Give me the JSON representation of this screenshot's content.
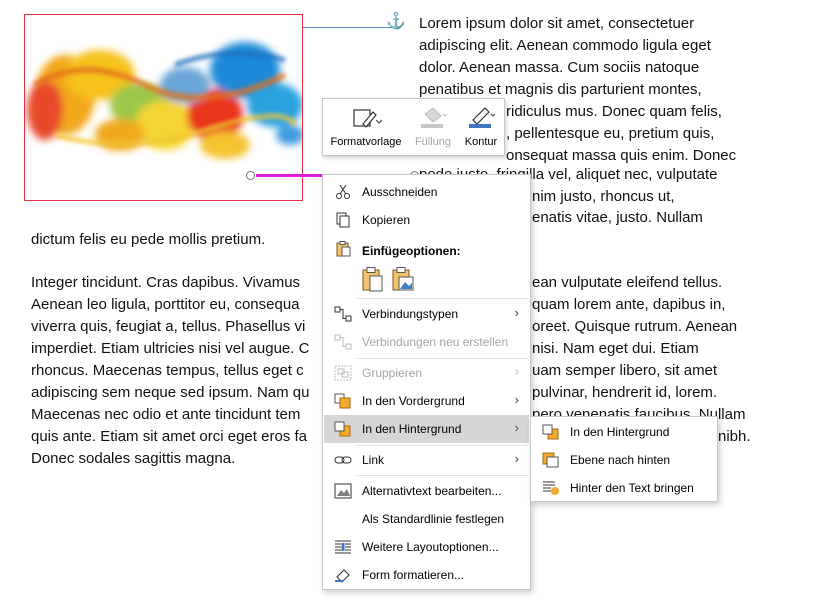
{
  "document": {
    "lines_right": [
      "Lorem ipsum dolor sit amet, consectetuer",
      "adipiscing elit. Aenean commodo ligula eget",
      "dolor. Aenean massa. Cum sociis natoque",
      "penatibus et magnis dis parturient montes,",
      "ridiculus mus. Donec quam felis,",
      ", pellentesque eu, pretium quis,",
      "onsequat massa quis enim. Donec",
      "pede justo, fringilla vel, aliquet nec, vulputate",
      "nim justo, rhoncus ut,",
      "enatis vitae, justo. Nullam"
    ],
    "line_dictum": "dictum felis eu pede mollis pretium.",
    "para2_left": [
      "Integer tincidunt. Cras dapibus. Vivamus",
      "Aenean leo ligula, porttitor eu, consequa",
      "viverra quis, feugiat a, tellus. Phasellus vi",
      "imperdiet. Etiam ultricies nisi vel augue. C",
      "rhoncus. Maecenas tempus, tellus eget c",
      "adipiscing sem neque sed ipsum. Nam qu",
      "Maecenas nec odio et ante tincidunt tem",
      "quis ante. Etiam sit amet orci eget eros fa",
      "Donec sodales sagittis magna."
    ],
    "para2_right": [
      "ean vulputate eleifend tellus.",
      "quam lorem ante, dapibus in,",
      "oreet. Quisque rutrum. Aenean",
      "nisi. Nam eget dui. Etiam",
      "uam semper libero, sit amet",
      "pulvinar, hendrerit id, lorem.",
      "pero venenatis faucibus. Nullam",
      "nibh."
    ]
  },
  "mini_toolbar": {
    "style_label": "Formatvorlage",
    "fill_label": "Füllung",
    "outline_label": "Kontur"
  },
  "context_menu": {
    "items": [
      {
        "label": "Ausschneiden",
        "icon": "scissors-icon"
      },
      {
        "label": "Kopieren",
        "icon": "copy-icon"
      },
      {
        "label": "Verbindungstypen",
        "icon": "connector-types-icon"
      },
      {
        "label": "Verbindungen neu erstellen",
        "icon": "reroute-icon"
      },
      {
        "label": "Gruppieren",
        "icon": "group-icon"
      },
      {
        "label": "In den Vordergrund",
        "icon": "bring-forward-icon"
      },
      {
        "label": "In den Hintergrund",
        "icon": "send-backward-icon"
      },
      {
        "label": "Link",
        "icon": "link-icon"
      },
      {
        "label": "Alternativtext bearbeiten...",
        "icon": "alt-text-icon"
      },
      {
        "label": "Als Standardlinie festlegen",
        "icon": ""
      },
      {
        "label": "Weitere Layoutoptionen...",
        "icon": "layout-options-icon"
      },
      {
        "label": "Form formatieren...",
        "icon": "format-shape-icon"
      }
    ],
    "paste_header": "Einfügeoptionen:"
  },
  "submenu": {
    "items": [
      {
        "label": "In den Hintergrund",
        "icon": "send-to-back-icon"
      },
      {
        "label": "Ebene nach hinten",
        "icon": "send-backward-one-icon"
      },
      {
        "label": "Hinter den Text bringen",
        "icon": "behind-text-icon"
      }
    ]
  },
  "colors": {
    "connector": "#e21dde",
    "highlight": "#d6d6d6",
    "accent": "#4472c4"
  }
}
